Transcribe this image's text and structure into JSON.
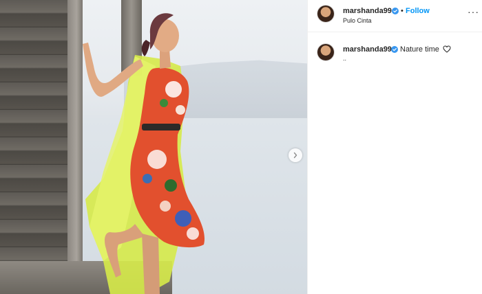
{
  "post": {
    "username": "marshanda99",
    "location": "Pulo Cinta",
    "follow_label": "Follow",
    "separator": "•",
    "more_label": "···",
    "caption": {
      "text": "Nature time",
      "extra": ".."
    }
  },
  "icons": {
    "verified": "verified-badge-icon",
    "heart": "heart-outline-icon",
    "carousel": "chevron-right-icon",
    "more": "more-options-icon"
  },
  "colors": {
    "accent": "#0095f6",
    "text": "#262626",
    "dress": "#e2502e",
    "cardigan": "#d9ec4a"
  }
}
